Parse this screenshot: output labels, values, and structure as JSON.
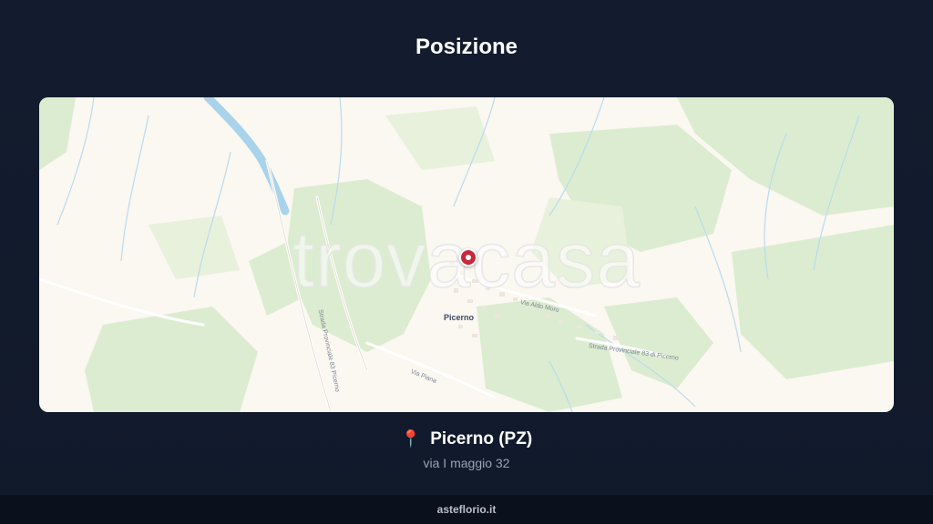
{
  "header": {
    "title": "Posizione"
  },
  "map": {
    "watermark": "trovacasa",
    "town_label": "Picerno",
    "street_labels": [
      "Strada Provinciale 83 Picerno",
      "Via Piana",
      "Via Aldo Moro",
      "Strada Provinciale 83 di Picerno"
    ],
    "marker_icon": "map-marker",
    "colors": {
      "land": "#fbf7f1",
      "vegetation": "#d9ebcc",
      "water": "#a9d3ea",
      "marker": "#c7283c"
    }
  },
  "location": {
    "icon": "pin-icon",
    "name": "Picerno (PZ)",
    "address": "via I maggio 32"
  },
  "footer": {
    "site": "asteflorio.it"
  }
}
